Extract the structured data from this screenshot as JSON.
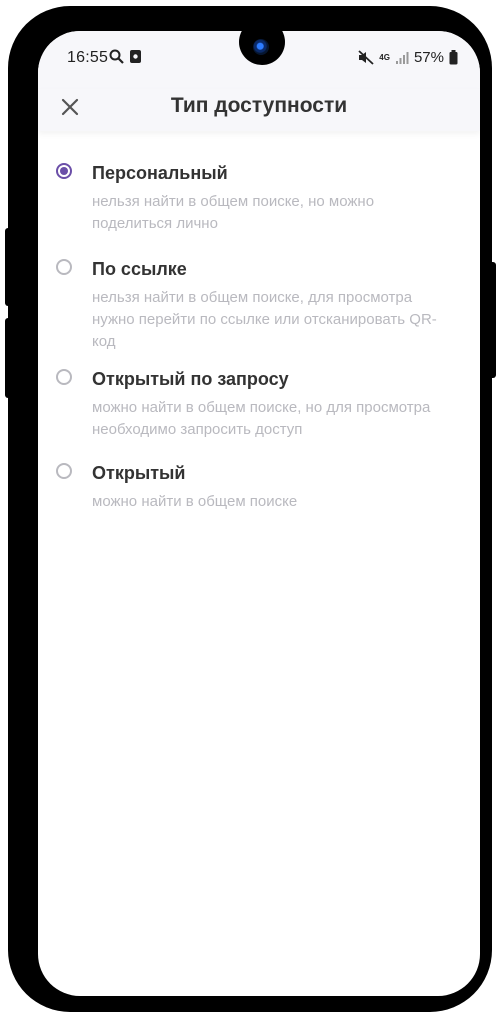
{
  "status_bar": {
    "time": "16:55",
    "battery": "57%",
    "network_badge": "4G"
  },
  "header": {
    "title": "Тип доступности"
  },
  "colors": {
    "accent": "#6b4fa8",
    "muted": "#b9b9bf",
    "title_text": "#333333"
  },
  "options": [
    {
      "title": "Персональный",
      "description": "нельзя найти в общем поиске, но можно поделиться лично",
      "selected": true
    },
    {
      "title": "По ссылке",
      "description": "нельзя найти в общем поиске, для просмотра нужно перейти по ссылке или отсканировать QR-код",
      "selected": false
    },
    {
      "title": "Открытый по запросу",
      "description": "можно найти в общем поиске, но для просмотра необходимо запросить доступ",
      "selected": false
    },
    {
      "title": "Открытый",
      "description": "можно найти в общем поиске",
      "selected": false
    }
  ]
}
